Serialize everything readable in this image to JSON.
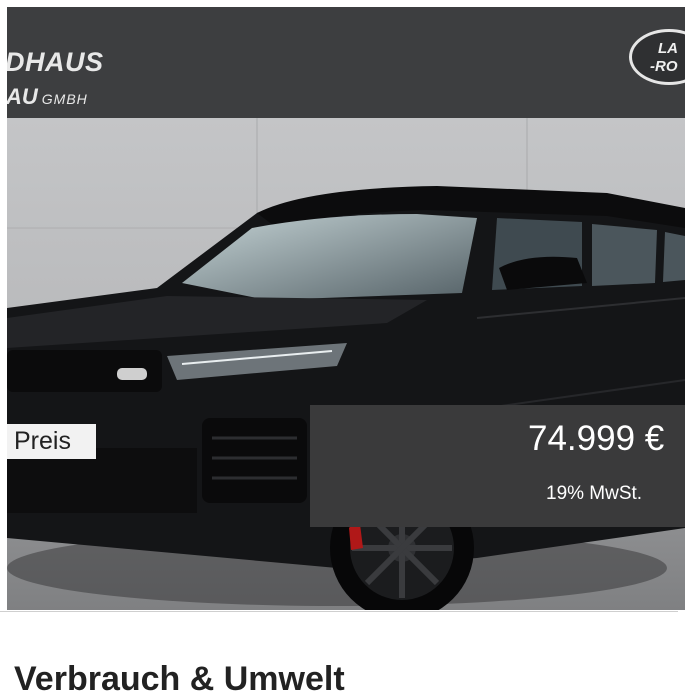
{
  "dealer": {
    "name_line1": "DHAUS",
    "name_line2": "AU",
    "name_suffix": "GMBH"
  },
  "brand_logo": {
    "line1": "LA",
    "line2": "-RO"
  },
  "vehicle_image": {
    "icon": "car-photo",
    "description_colors": {
      "body": "#111214",
      "background_wall": "#bdbdbd",
      "ground": "#8f9092"
    }
  },
  "price": {
    "label": "Preis",
    "value": "74.999 €",
    "vat_note": "19% MwSt."
  },
  "section": {
    "title": "Verbrauch & Umwelt"
  },
  "colors": {
    "header_bg": "#3d3e40",
    "price_box_bg": "#3a3a3b"
  }
}
